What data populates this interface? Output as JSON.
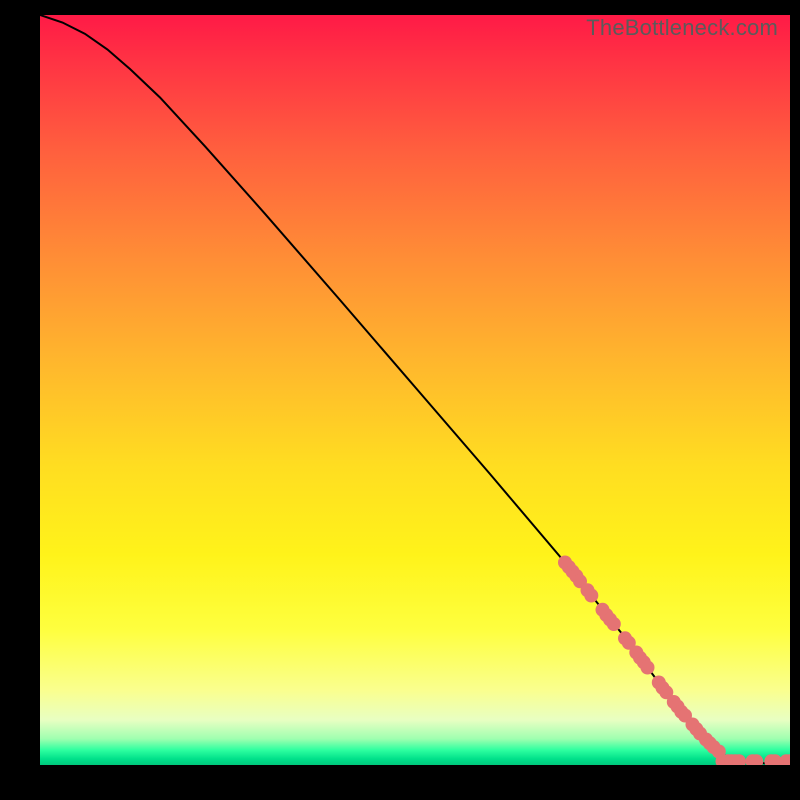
{
  "watermark": "TheBottleneck.com",
  "chart_data": {
    "type": "line",
    "title": "",
    "xlabel": "",
    "ylabel": "",
    "xlim": [
      0,
      100
    ],
    "ylim": [
      0,
      100
    ],
    "grid": false,
    "curve": {
      "name": "bottleneck-curve",
      "points": [
        {
          "x": 0.0,
          "y": 100.0
        },
        {
          "x": 3.0,
          "y": 99.0
        },
        {
          "x": 6.0,
          "y": 97.5
        },
        {
          "x": 9.0,
          "y": 95.4
        },
        {
          "x": 12.0,
          "y": 92.8
        },
        {
          "x": 16.0,
          "y": 89.0
        },
        {
          "x": 22.0,
          "y": 82.5
        },
        {
          "x": 30.0,
          "y": 73.5
        },
        {
          "x": 40.0,
          "y": 62.0
        },
        {
          "x": 50.0,
          "y": 50.4
        },
        {
          "x": 60.0,
          "y": 38.8
        },
        {
          "x": 70.0,
          "y": 27.0
        },
        {
          "x": 78.0,
          "y": 17.0
        },
        {
          "x": 84.0,
          "y": 9.0
        },
        {
          "x": 88.0,
          "y": 4.0
        },
        {
          "x": 90.0,
          "y": 2.0
        },
        {
          "x": 92.5,
          "y": 0.6
        },
        {
          "x": 95.0,
          "y": 0.3
        },
        {
          "x": 98.0,
          "y": 0.2
        },
        {
          "x": 100.0,
          "y": 0.2
        }
      ]
    },
    "highlight_points": {
      "name": "highlight-markers",
      "color": "#e57373",
      "points": [
        {
          "x": 70.0,
          "y": 27.0
        },
        {
          "x": 70.5,
          "y": 26.4
        },
        {
          "x": 71.0,
          "y": 25.8
        },
        {
          "x": 71.5,
          "y": 25.2
        },
        {
          "x": 72.0,
          "y": 24.5
        },
        {
          "x": 73.0,
          "y": 23.3
        },
        {
          "x": 73.5,
          "y": 22.6
        },
        {
          "x": 75.0,
          "y": 20.7
        },
        {
          "x": 75.5,
          "y": 20.0
        },
        {
          "x": 76.0,
          "y": 19.4
        },
        {
          "x": 76.5,
          "y": 18.8
        },
        {
          "x": 78.0,
          "y": 16.9
        },
        {
          "x": 78.5,
          "y": 16.3
        },
        {
          "x": 79.5,
          "y": 15.0
        },
        {
          "x": 80.0,
          "y": 14.3
        },
        {
          "x": 80.5,
          "y": 13.7
        },
        {
          "x": 81.0,
          "y": 13.0
        },
        {
          "x": 82.5,
          "y": 11.0
        },
        {
          "x": 83.0,
          "y": 10.3
        },
        {
          "x": 83.5,
          "y": 9.7
        },
        {
          "x": 84.5,
          "y": 8.4
        },
        {
          "x": 85.0,
          "y": 7.8
        },
        {
          "x": 85.5,
          "y": 7.1
        },
        {
          "x": 86.0,
          "y": 6.6
        },
        {
          "x": 87.0,
          "y": 5.4
        },
        {
          "x": 87.5,
          "y": 4.8
        },
        {
          "x": 88.0,
          "y": 4.2
        },
        {
          "x": 88.8,
          "y": 3.4
        },
        {
          "x": 89.3,
          "y": 2.9
        },
        {
          "x": 89.8,
          "y": 2.4
        },
        {
          "x": 90.5,
          "y": 1.8
        },
        {
          "x": 91.0,
          "y": 0.5
        },
        {
          "x": 91.7,
          "y": 0.5
        },
        {
          "x": 92.2,
          "y": 0.5
        },
        {
          "x": 92.7,
          "y": 0.5
        },
        {
          "x": 93.2,
          "y": 0.5
        },
        {
          "x": 95.0,
          "y": 0.5
        },
        {
          "x": 95.5,
          "y": 0.5
        },
        {
          "x": 97.5,
          "y": 0.5
        },
        {
          "x": 98.0,
          "y": 0.5
        },
        {
          "x": 99.5,
          "y": 0.5
        },
        {
          "x": 100.0,
          "y": 0.5
        }
      ]
    }
  }
}
